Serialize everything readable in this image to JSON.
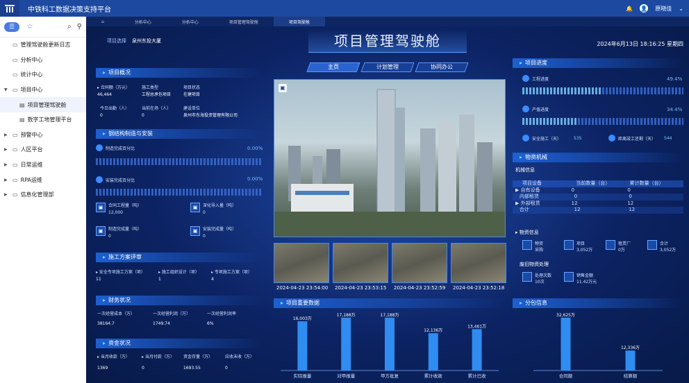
{
  "app": {
    "title": "中铁科工数据决策支持平台",
    "user": "原晓佳"
  },
  "sidebar": {
    "items": [
      {
        "label": "管理驾驶舱更新日志",
        "level": 0,
        "arrow": ""
      },
      {
        "label": "分析中心",
        "level": 0,
        "arrow": ""
      },
      {
        "label": "统计中心",
        "level": 0,
        "arrow": ""
      },
      {
        "label": "项目中心",
        "level": 0,
        "arrow": "▼"
      },
      {
        "label": "项目管理驾驶舱",
        "level": 1,
        "arrow": ""
      },
      {
        "label": "数字工地管理平台",
        "level": 1,
        "arrow": ""
      },
      {
        "label": "预警中心",
        "level": 0,
        "arrow": "▶"
      },
      {
        "label": "人区平台",
        "level": 0,
        "arrow": "▶"
      },
      {
        "label": "日常运维",
        "level": 0,
        "arrow": "▶"
      },
      {
        "label": "RPA运维",
        "level": 0,
        "arrow": "▶"
      },
      {
        "label": "信息化管理部",
        "level": 0,
        "arrow": "▶"
      }
    ]
  },
  "tabs": [
    "分析中心",
    "分析中心",
    "项目管理驾驶舱",
    "项目驾驶舱"
  ],
  "dash": {
    "title": "项目管理驾驶舱",
    "datetime": "2024年6月13日 18:16:25 星期四",
    "select_label": "项目选择",
    "select_value": "泉州东投大厦",
    "nav": [
      "主页",
      "计划管理",
      "协同办公"
    ]
  },
  "overview": {
    "header": "项目概况",
    "r1": [
      {
        "k": "合同额（万元）",
        "v": "46,464"
      },
      {
        "k": "施工类型",
        "v": "工程总承包项目"
      },
      {
        "k": "项目状态",
        "v": "在建项目"
      }
    ],
    "r2": [
      {
        "k": "今日出勤（人）",
        "v": "0"
      },
      {
        "k": "当前在场（人）",
        "v": "0"
      },
      {
        "k": "建设单位",
        "v": "泉州市东海投资管理有限公司"
      }
    ]
  },
  "steel": {
    "header": "钢结构制造与安装",
    "p1_label": "制造完成百分比",
    "p1": "0.00%",
    "p2_label": "安装完成百分比",
    "p2": "0.00%",
    "boxes": [
      {
        "k": "合同工程量（吨）",
        "v": "12,000"
      },
      {
        "k": "深化导入量（吨）",
        "v": "0"
      },
      {
        "k": "制造完成量（吨）",
        "v": "0"
      },
      {
        "k": "安装完成量（吨）",
        "v": "0"
      }
    ]
  },
  "plan": {
    "header": "施工方案评审",
    "items": [
      {
        "k": "安全专项施工方案（项）",
        "v": "11"
      },
      {
        "k": "施工组织设计（项）",
        "v": "1"
      },
      {
        "k": "专项施工方案（项）",
        "v": "4"
      }
    ]
  },
  "finance": {
    "header": "财务状况",
    "items": [
      {
        "k": "一次经营成本（万）",
        "v": "38164.7"
      },
      {
        "k": "一次经营利润（万）",
        "v": "1749.74"
      },
      {
        "k": "一次经营利润率",
        "v": "6%"
      }
    ]
  },
  "fund": {
    "header": "资金状况",
    "items": [
      {
        "k": "当月收款（万）",
        "v": "1369"
      },
      {
        "k": "当月付款（万）",
        "v": "0"
      },
      {
        "k": "资金存量（万）",
        "v": "1693.55"
      },
      {
        "k": "应收未收（万）",
        "v": "0"
      }
    ]
  },
  "progress": {
    "header": "项目进度",
    "work_label": "工程进度",
    "work": "49.4%",
    "work_frac": 0.494,
    "output_label": "产值进度",
    "output": "34.4%",
    "output_frac": 0.344,
    "safe_label": "安全施工（天）",
    "safe": "535",
    "remain_label": "距离竣工还剩（天）",
    "remain": "544"
  },
  "machine": {
    "header": "物资机械",
    "sub": "机械信息",
    "cols": [
      "项目设备",
      "当前数量（台）",
      "累计数量（台）"
    ],
    "rows": [
      [
        "▶ 自有设备",
        "0",
        "0"
      ],
      [
        "内部租赁",
        "0",
        "0"
      ],
      [
        "▶ 外部租赁",
        "12",
        "12"
      ],
      [
        "合计",
        "12",
        "12"
      ]
    ],
    "mat_header": "物资信息",
    "mat": [
      {
        "k": "物资",
        "v": "采购"
      },
      {
        "k": "项目",
        "v": "3,052万"
      },
      {
        "k": "租赁厂",
        "v": "0万"
      },
      {
        "k": "合计",
        "v": "3,052万"
      }
    ],
    "waste_header": "废旧物资处理",
    "waste": [
      {
        "k": "处理次数",
        "v": "10次"
      },
      {
        "k": "销售金额",
        "v": "11.42万元"
      }
    ]
  },
  "photos": {
    "times": [
      "2024-04-23 23:54:00",
      "2024-04-23 23:53:15",
      "2024-04-23 23:52:59",
      "2024-04-23 23:52:18"
    ]
  },
  "chart_data": [
    {
      "type": "bar",
      "title": "项目重要数据",
      "categories": [
        "实际报量",
        "对甲报量",
        "甲方批复",
        "累计收款",
        "累计已收"
      ],
      "values": [
        16003.7,
        17188,
        17188,
        12136,
        13461
      ],
      "labels": [
        "16,003万",
        "17,188万",
        "17,188万",
        "12,136万",
        "13,461万"
      ]
    },
    {
      "type": "bar",
      "title": "分包信息",
      "categories": [
        "合同额",
        "结算额"
      ],
      "values": [
        32625,
        12336
      ],
      "labels": [
        "32,625万",
        "12,336万"
      ]
    }
  ]
}
